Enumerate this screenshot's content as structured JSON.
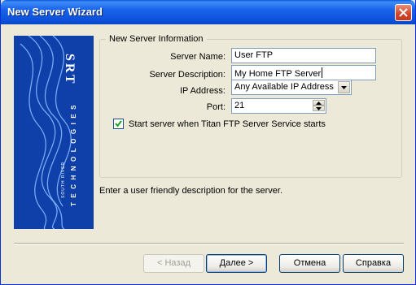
{
  "window": {
    "title": "New Server Wizard"
  },
  "banner": {
    "brand": "SRT",
    "company_small": "SOUTH RIVER",
    "company_large": "TECHNOLOGIES",
    "colors": {
      "background": "#0f3fa8",
      "waves": "#7fb6ff"
    }
  },
  "group": {
    "legend": "New Server Information",
    "server_name": {
      "label": "Server Name:",
      "value": "User FTP"
    },
    "server_description": {
      "label": "Server Description:",
      "value": "My Home FTP Server"
    },
    "ip_address": {
      "label": "IP Address:",
      "value": "Any Available IP Address"
    },
    "port": {
      "label": "Port:",
      "value": "21"
    },
    "start_checkbox": {
      "label": "Start server when Titan FTP Server Service starts",
      "checked": true
    }
  },
  "hint": "Enter a user friendly description for the server.",
  "buttons": {
    "back": "< Назад",
    "next": "Далее >",
    "cancel": "Отмена",
    "help": "Справка"
  }
}
